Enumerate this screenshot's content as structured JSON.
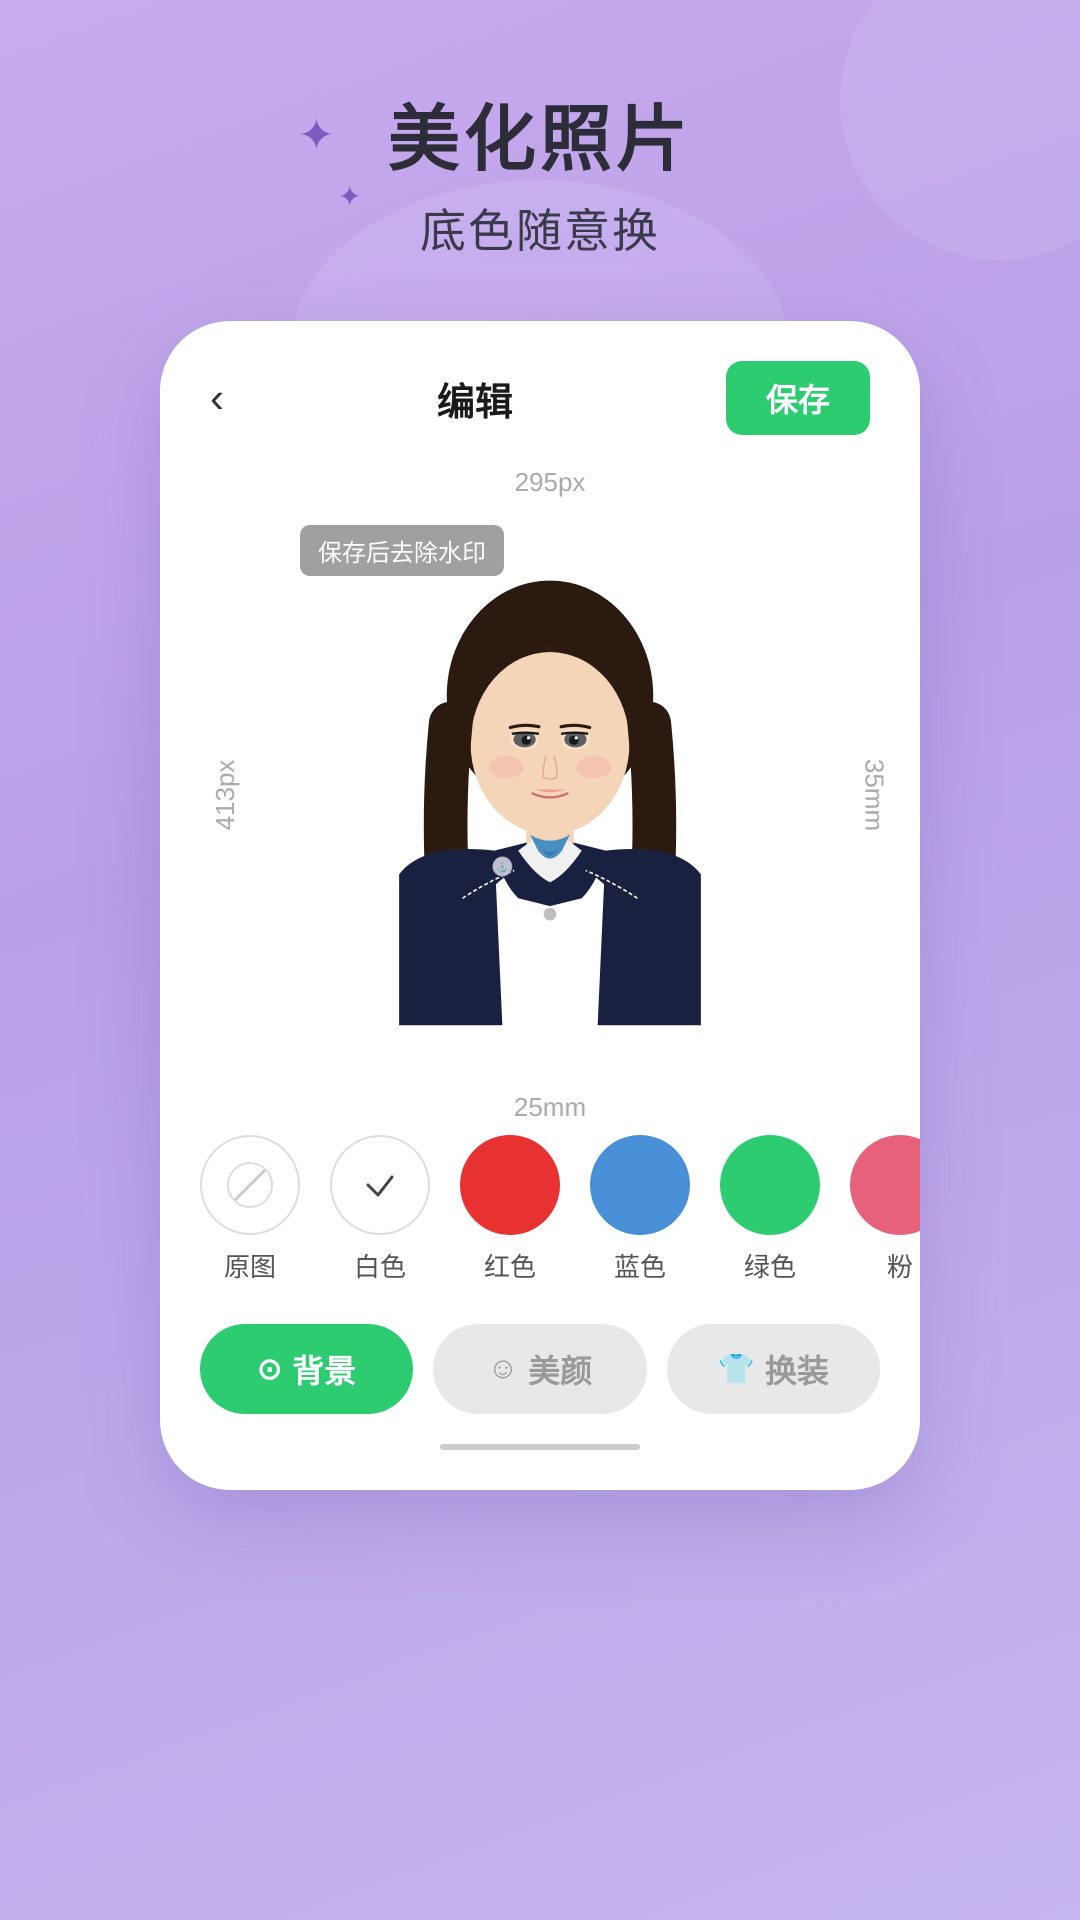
{
  "background": {
    "gradient_start": "#c9aaee",
    "gradient_end": "#c5b5f0"
  },
  "header": {
    "title": "美化照片",
    "subtitle": "底色随意换"
  },
  "phone": {
    "nav": {
      "back_icon": "‹",
      "title": "编辑",
      "save_label": "保存"
    },
    "photo": {
      "width_label": "295px",
      "height_label": "413px",
      "right_label": "35mm",
      "bottom_label": "25mm",
      "watermark_label": "保存后去除水印"
    },
    "colors": [
      {
        "id": "original",
        "label": "原图",
        "color": "#ffffff",
        "type": "slash"
      },
      {
        "id": "white",
        "label": "白色",
        "color": "#ffffff",
        "type": "check"
      },
      {
        "id": "red",
        "label": "红色",
        "color": "#e83232",
        "type": "fill"
      },
      {
        "id": "blue",
        "label": "蓝色",
        "color": "#4a90d9",
        "type": "fill"
      },
      {
        "id": "green",
        "label": "绿色",
        "color": "#2ecc71",
        "type": "fill"
      },
      {
        "id": "pink",
        "label": "粉",
        "color": "#e8617a",
        "type": "fill"
      }
    ],
    "tabs": [
      {
        "id": "background",
        "label": "背景",
        "active": true,
        "icon": "⊙"
      },
      {
        "id": "beauty",
        "label": "美颜",
        "active": false,
        "icon": "☺"
      },
      {
        "id": "outfit",
        "label": "换装",
        "active": false,
        "icon": "👕"
      }
    ]
  }
}
